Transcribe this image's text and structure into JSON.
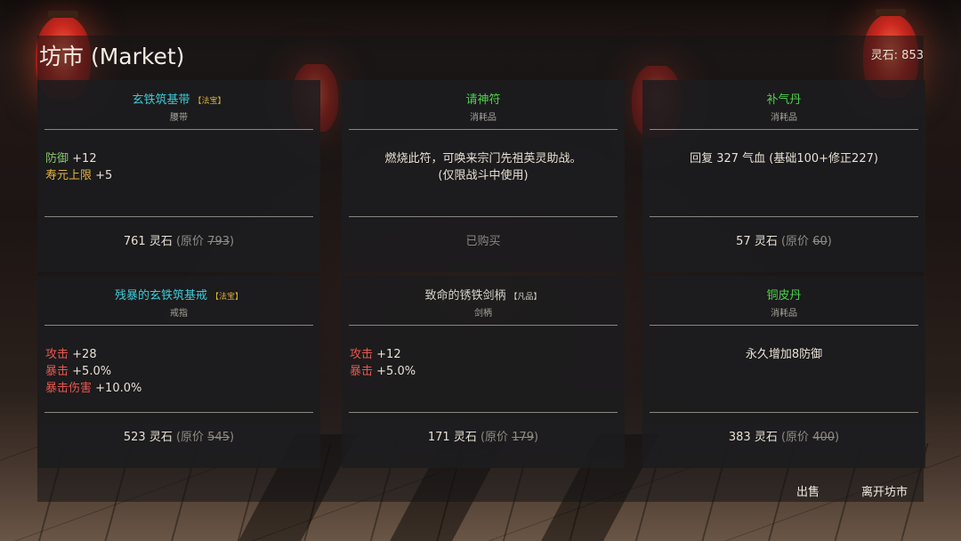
{
  "header": {
    "title": "坊市 (Market)",
    "currency": "灵石: 853"
  },
  "items": [
    {
      "name": "玄铁筑基带",
      "rarity": "【法宝】",
      "category": "腰带",
      "stats": [
        {
          "label": "防御",
          "value": "+12",
          "color": "#86c46c"
        },
        {
          "label": "寿元上限",
          "value": "+5",
          "color": "#e2b23c"
        }
      ],
      "price": "761 灵石",
      "orig_label": "(原价",
      "orig_value": "793",
      "orig_close": ")"
    },
    {
      "name": "请神符",
      "category": "消耗品",
      "desc": [
        "燃烧此符，可唤来宗门先祖英灵助战。",
        "(仅限战斗中使用)"
      ],
      "status": "已购买"
    },
    {
      "name": "补气丹",
      "category": "消耗品",
      "desc": [
        "回复 327 气血 (基础100+修正227)"
      ],
      "price": "57 灵石",
      "orig_label": "(原价",
      "orig_value": "60",
      "orig_close": ")"
    },
    {
      "name": "残暴的玄铁筑基戒",
      "rarity": "【法宝】",
      "category": "戒指",
      "stats": [
        {
          "label": "攻击",
          "value": "+28"
        },
        {
          "label": "暴击",
          "value": "+5.0%"
        },
        {
          "label": "暴击伤害",
          "value": "+10.0%"
        }
      ],
      "price": "523 灵石",
      "orig_label": "(原价",
      "orig_value": "545",
      "orig_close": ")"
    },
    {
      "name": "致命的锈铁剑柄",
      "rarity": "【凡品】",
      "category": "剑柄",
      "stats": [
        {
          "label": "攻击",
          "value": "+12"
        },
        {
          "label": "暴击",
          "value": "+5.0%"
        }
      ],
      "price": "171 灵石",
      "orig_label": "(原价",
      "orig_value": "179",
      "orig_close": ")"
    },
    {
      "name": "铜皮丹",
      "category": "消耗品",
      "desc": [
        "永久增加8防御"
      ],
      "price": "383 灵石",
      "orig_label": "(原价",
      "orig_value": "400",
      "orig_close": ")"
    }
  ],
  "actions": {
    "sell": "出售",
    "leave": "离开坊市"
  },
  "colors": {
    "name_cyan": "#3ec8d6",
    "name_green": "#4ed24a",
    "rarity_gold": "#d8b03a",
    "stat_red": "#e4574f"
  }
}
